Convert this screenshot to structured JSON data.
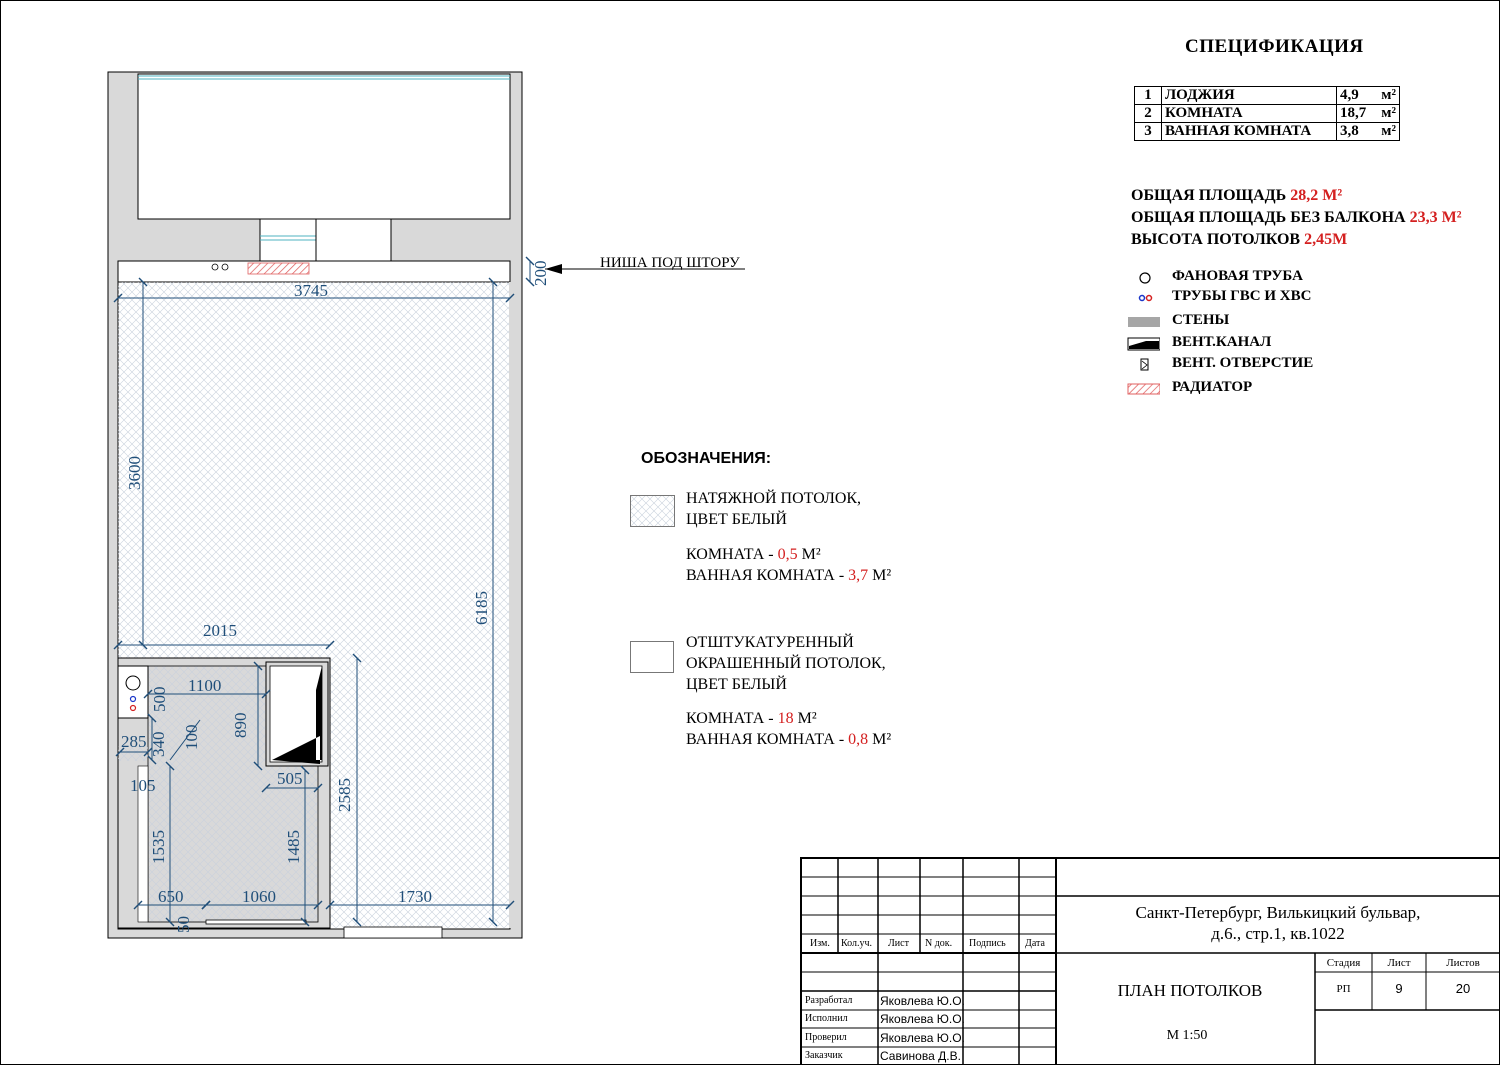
{
  "spec": {
    "title": "СПЕЦИФИКАЦИЯ",
    "rows": [
      {
        "num": "1",
        "name": "ЛОДЖИЯ",
        "value": "4,9",
        "unit": "м²"
      },
      {
        "num": "2",
        "name": "КОМНАТА",
        "value": "18,7",
        "unit": "м²"
      },
      {
        "num": "3",
        "name": "ВАННАЯ КОМНАТА",
        "value": "3,8",
        "unit": "м²"
      }
    ]
  },
  "totals": {
    "total_label": "ОБЩАЯ ПЛОЩАДЬ",
    "total_value": "28,2 М²",
    "no_balcony_label": "ОБЩАЯ ПЛОЩАДЬ БЕЗ БАЛКОНА",
    "no_balcony_value": "23,3 М²",
    "height_label": "ВЫСОТА ПОТОЛКОВ",
    "height_value": "2,45М"
  },
  "legend": [
    {
      "label": "ФАНОВАЯ ТРУБА",
      "icon": "pipe-circle-icon"
    },
    {
      "label": "ТРУБЫ ГВС И ХВС",
      "icon": "water-pipes-icon"
    },
    {
      "label": "СТЕНЫ",
      "icon": "wall-swatch-icon"
    },
    {
      "label": "ВЕНТ.КАНАЛ",
      "icon": "vent-channel-icon"
    },
    {
      "label": "ВЕНТ. ОТВЕРСТИЕ",
      "icon": "vent-hole-icon"
    },
    {
      "label": "РАДИАТОР",
      "icon": "radiator-hatch-icon"
    }
  ],
  "oboz": {
    "title": "ОБОЗНАЧЕНИЯ:",
    "item1": {
      "line1": "НАТЯЖНОЙ ПОТОЛОК,",
      "line2": "ЦВЕТ БЕЛЫЙ",
      "room_label": "КОМНАТА - ",
      "room_value": "0,5",
      "bath_label": "ВАННАЯ КОМНАТА - ",
      "bath_value": "3,7",
      "unit": " М²"
    },
    "item2": {
      "line1": "ОТШТУКАТУРЕННЫЙ",
      "line2": "ОКРАШЕННЫЙ ПОТОЛОК,",
      "line3": "ЦВЕТ БЕЛЫЙ",
      "room_label": "КОМНАТА - ",
      "room_value": "18",
      "bath_label": "ВАННАЯ КОМНАТА - ",
      "bath_value": "0,8",
      "unit": " М²"
    }
  },
  "plan": {
    "curtain_niche": "НИША ПОД ШТОРУ",
    "dims": [
      "3745",
      "200",
      "3600",
      "6185",
      "2015",
      "1100",
      "500",
      "890",
      "285",
      "340",
      "100",
      "105",
      "505",
      "2585",
      "1535",
      "1485",
      "650",
      "1060",
      "1730",
      "50"
    ]
  },
  "stamp": {
    "address_line1": "Санкт-Петербург, Вилькицкий бульвар,",
    "address_line2": "д.6., стр.1, кв.1022",
    "sheet_title": "ПЛАН ПОТОЛКОВ",
    "scale": "М 1:50",
    "col_headers": [
      "Изм.",
      "Кол.уч.",
      "Лист",
      "N док.",
      "Подпись",
      "Дата"
    ],
    "stage_label": "Стадия",
    "sheet_label": "Лист",
    "sheets_label": "Листов",
    "stage_value": "РП",
    "sheet_value": "9",
    "sheets_value": "20",
    "roles": [
      {
        "role": "Разработал",
        "name": "Яковлева Ю.О."
      },
      {
        "role": "Исполнил",
        "name": "Яковлева Ю.О."
      },
      {
        "role": "Проверил",
        "name": "Яковлева Ю.О."
      },
      {
        "role": "Заказчик",
        "name": "Савинова Д.В."
      }
    ]
  },
  "colors": {
    "dimension": "#1f4e79",
    "accent_red": "#d42020",
    "wall": "#d9d9d9",
    "radiator": "#e06060"
  }
}
